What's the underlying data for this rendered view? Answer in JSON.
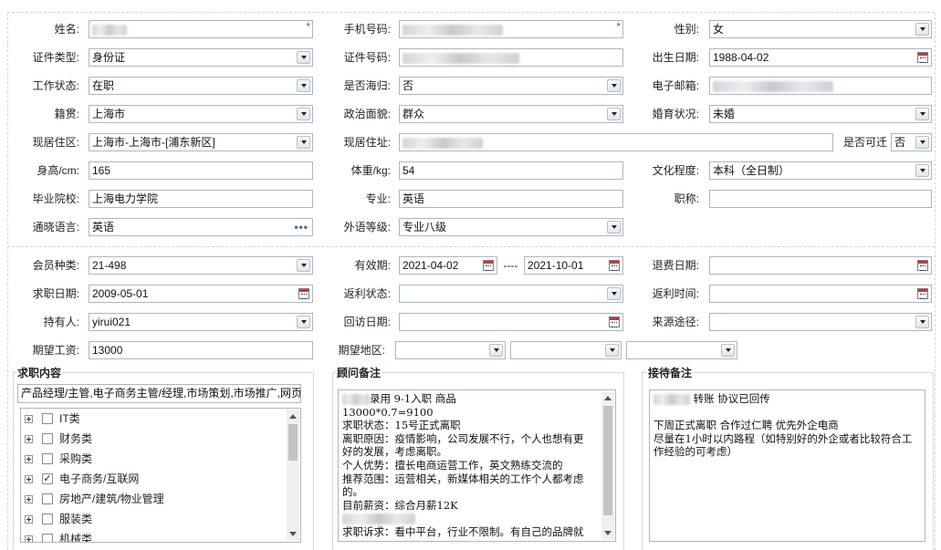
{
  "basic": {
    "name": {
      "label": "姓名:",
      "value": "",
      "required": "*"
    },
    "mobile": {
      "label": "手机号码:",
      "value": "",
      "required": "*"
    },
    "gender": {
      "label": "性别:",
      "value": "女"
    },
    "id_type": {
      "label": "证件类型:",
      "value": "身份证"
    },
    "id_number": {
      "label": "证件号码:",
      "value": ""
    },
    "birth_date": {
      "label": "出生日期:",
      "value": "1988-04-02"
    },
    "work_status": {
      "label": "工作状态:",
      "value": "在职"
    },
    "returnee": {
      "label": "是否海归:",
      "value": "否"
    },
    "email": {
      "label": "电子邮箱:",
      "value": ""
    },
    "native_place": {
      "label": "籍贯:",
      "value": "上海市"
    },
    "political": {
      "label": "政治面貌:",
      "value": "群众"
    },
    "marital": {
      "label": "婚育状况:",
      "value": "未婚"
    },
    "residence_area": {
      "label": "现居住区:",
      "value": "上海市-上海市-[浦东新区]"
    },
    "address": {
      "label": "现居住址:",
      "value": ""
    },
    "relocate": {
      "label": "是否可迁",
      "value": "否"
    },
    "height": {
      "label": "身高/cm:",
      "value": "165"
    },
    "weight": {
      "label": "体重/kg:",
      "value": "54"
    },
    "education": {
      "label": "文化程度:",
      "value": "本科（全日制）"
    },
    "school": {
      "label": "毕业院校:",
      "value": "上海电力学院"
    },
    "major": {
      "label": "专业:",
      "value": "英语"
    },
    "title": {
      "label": "职称:",
      "value": ""
    },
    "language": {
      "label": "通晓语言:",
      "value": "英语",
      "more": "•••"
    },
    "foreign_level": {
      "label": "外语等级:",
      "value": "专业八级"
    }
  },
  "membership": {
    "member_type": {
      "label": "会员种类:",
      "value": "21-498"
    },
    "valid_period": {
      "label": "有效期:",
      "start": "2021-04-02",
      "separator": "----",
      "end": "2021-10-01"
    },
    "refund_date": {
      "label": "退费日期:",
      "value": ""
    },
    "job_seek_date": {
      "label": "求职日期:",
      "value": "2009-05-01"
    },
    "rebate_status": {
      "label": "返利状态:",
      "value": ""
    },
    "rebate_time": {
      "label": "返利时间:",
      "value": ""
    },
    "holder": {
      "label": "持有人:",
      "value": "yirui021"
    },
    "return_visit": {
      "label": "回访日期:",
      "value": ""
    },
    "source": {
      "label": "来源途径:",
      "value": ""
    },
    "expected_salary": {
      "label": "期望工资:",
      "value": "13000"
    },
    "expected_area": {
      "label": "期望地区:",
      "values": [
        "",
        "",
        ""
      ]
    }
  },
  "job_content": {
    "legend": "求职内容",
    "summary": "产品经理/主管,电子商务主管/经理,市场策划,市场推广,网页",
    "tree": [
      {
        "label": "IT类",
        "checked": false
      },
      {
        "label": "财务类",
        "checked": false
      },
      {
        "label": "采购类",
        "checked": false
      },
      {
        "label": "电子商务/互联网",
        "checked": true,
        "mark": "✓"
      },
      {
        "label": "房地产/建筑/物业管理",
        "checked": false
      },
      {
        "label": "服装类",
        "checked": false
      },
      {
        "label": "机械类",
        "checked": false
      }
    ]
  },
  "consultant_notes": {
    "legend": "顾问备注",
    "lines": [
      "录用  9-1入职   商品",
      "13000*0.7=9100",
      "求职状态：15号正式离职",
      "离职原因：疫情影响，公司发展不行，个人也想有更",
      "好的发展，考虑离职。",
      "个人优势：擅长电商运营工作，英文熟练交流的",
      "推荐范围：运营相关，新媒体相关的工作个人都考虑",
      "的。",
      "目前薪资：综合月薪12K",
      "",
      "求职诉求：看中平台，行业不限制。有自己的品牌就"
    ]
  },
  "reception_notes": {
    "legend": "接待备注",
    "lines": [
      "转账  协议已回传",
      "",
      "下周正式离职 合作过仁聘 优先外企电商",
      "尽量在1小时以内路程（如特别好的外企或者比较符合工",
      "作经验的可考虑）"
    ]
  }
}
